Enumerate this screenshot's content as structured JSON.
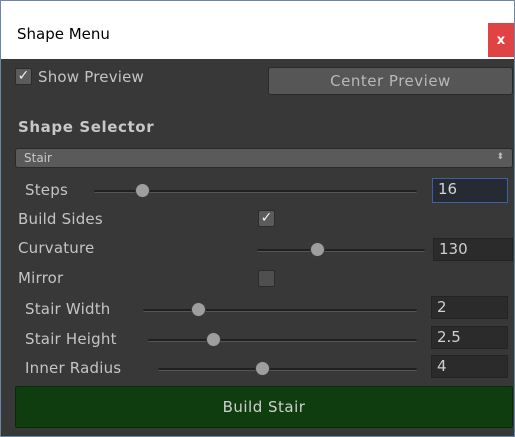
{
  "window": {
    "title": "Shape Menu",
    "close_glyph": "x"
  },
  "preview": {
    "show_label": "Show Preview",
    "show_checked": "✓",
    "center_button": "Center Preview"
  },
  "selector": {
    "heading": "Shape Selector",
    "selected": "Stair",
    "arrow": "⬍"
  },
  "steps": {
    "label": "Steps",
    "value": "16",
    "slider_fraction": 0.15
  },
  "build_sides": {
    "label": "Build Sides",
    "check": "✓"
  },
  "curvature": {
    "label": "Curvature",
    "value": "130",
    "slider_fraction": 0.36
  },
  "mirror": {
    "label": "Mirror",
    "check": ""
  },
  "stair_width": {
    "label": "Stair Width",
    "value": "2",
    "slider_fraction": 0.2
  },
  "stair_height": {
    "label": "Stair Height",
    "value": "2.5",
    "slider_fraction": 0.24
  },
  "inner_radius": {
    "label": "Inner Radius",
    "value": "4",
    "slider_fraction": 0.4
  },
  "build_button": {
    "label": "Build Stair"
  },
  "colors": {
    "build_green": "#0f3d10",
    "focus_blue": "#3f5ea6",
    "close_red": "#e04343"
  }
}
